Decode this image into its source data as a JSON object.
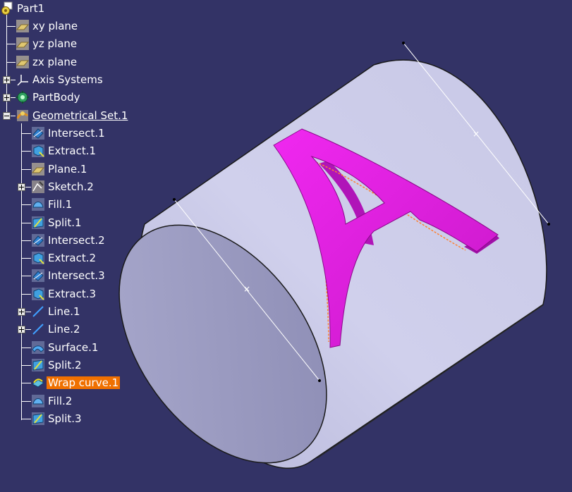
{
  "tree": {
    "root": {
      "label": "Part1",
      "icon": "part-icon"
    },
    "level1": [
      {
        "id": "xy-plane",
        "label": "xy plane",
        "icon": "plane-icon",
        "expander": "none"
      },
      {
        "id": "yz-plane",
        "label": "yz plane",
        "icon": "plane-icon",
        "expander": "none"
      },
      {
        "id": "zx-plane",
        "label": "zx plane",
        "icon": "plane-icon",
        "expander": "none"
      },
      {
        "id": "axis-systems",
        "label": "Axis Systems",
        "icon": "axis-systems-icon",
        "expander": "plus"
      },
      {
        "id": "partbody",
        "label": "PartBody",
        "icon": "gear-icon",
        "expander": "plus"
      },
      {
        "id": "geometrical-set-1",
        "label": "Geometrical Set.1",
        "icon": "geometrical-set-icon",
        "expander": "minus",
        "underline": true
      }
    ],
    "level2": [
      {
        "id": "intersect-1",
        "label": "Intersect.1",
        "icon": "intersect-icon",
        "expander": "none"
      },
      {
        "id": "extract-1",
        "label": "Extract.1",
        "icon": "extract-icon",
        "expander": "none"
      },
      {
        "id": "plane-1",
        "label": "Plane.1",
        "icon": "plane-icon",
        "expander": "none"
      },
      {
        "id": "sketch-2",
        "label": "Sketch.2",
        "icon": "sketch-icon",
        "expander": "plus"
      },
      {
        "id": "fill-1",
        "label": "Fill.1",
        "icon": "fill-icon",
        "expander": "none"
      },
      {
        "id": "split-1",
        "label": "Split.1",
        "icon": "split-icon",
        "expander": "none"
      },
      {
        "id": "intersect-2",
        "label": "Intersect.2",
        "icon": "intersect-icon",
        "expander": "none"
      },
      {
        "id": "extract-2",
        "label": "Extract.2",
        "icon": "extract-icon",
        "expander": "none"
      },
      {
        "id": "intersect-3",
        "label": "Intersect.3",
        "icon": "intersect-icon",
        "expander": "none"
      },
      {
        "id": "extract-3",
        "label": "Extract.3",
        "icon": "extract-icon",
        "expander": "none"
      },
      {
        "id": "line-1",
        "label": "Line.1",
        "icon": "line-icon",
        "expander": "plus"
      },
      {
        "id": "line-2",
        "label": "Line.2",
        "icon": "line-icon",
        "expander": "plus"
      },
      {
        "id": "surface-1",
        "label": "Surface.1",
        "icon": "surface-icon",
        "expander": "none"
      },
      {
        "id": "split-2",
        "label": "Split.2",
        "icon": "split-icon",
        "expander": "none"
      },
      {
        "id": "wrap-curve-1",
        "label": "Wrap curve.1",
        "icon": "wrap-curve-icon",
        "expander": "none",
        "selected": true
      },
      {
        "id": "fill-2",
        "label": "Fill.2",
        "icon": "fill-icon",
        "expander": "none"
      },
      {
        "id": "split-3",
        "label": "Split.3",
        "icon": "split-icon",
        "expander": "none"
      }
    ]
  },
  "colors": {
    "background": "#333366",
    "tree_text": "#ffffff",
    "selection": "#f07000",
    "cylinder_body": "#c8c8e6",
    "cylinder_cap": "#9898bf",
    "letter": "#e020e0",
    "letter_side": "#a010a8"
  },
  "viewport": {
    "object": "cylinder-with-wrapped-letter",
    "letter": "A"
  }
}
